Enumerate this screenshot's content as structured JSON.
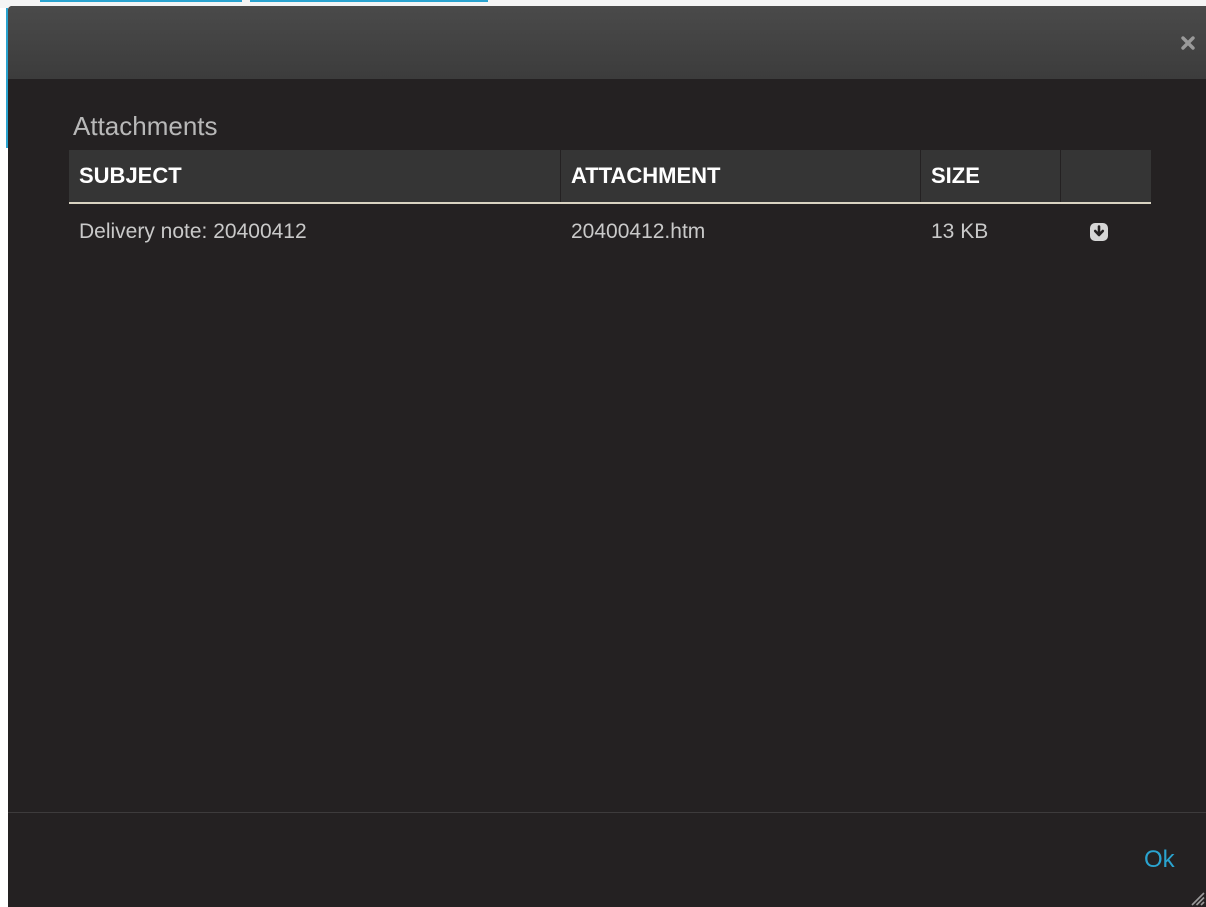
{
  "dialog": {
    "heading": "Attachments",
    "close_icon": "close-icon",
    "ok_label": "Ok"
  },
  "table": {
    "columns": [
      "SUBJECT",
      "ATTACHMENT",
      "SIZE",
      ""
    ],
    "rows": [
      {
        "subject": "Delivery note: 20400412",
        "attachment": "20400412.htm",
        "size": "13 KB",
        "action_icon": "download-icon"
      }
    ]
  },
  "colors": {
    "accent": "#2aa3cf",
    "dialog_bg": "#242122",
    "header_bg": "#353535"
  }
}
